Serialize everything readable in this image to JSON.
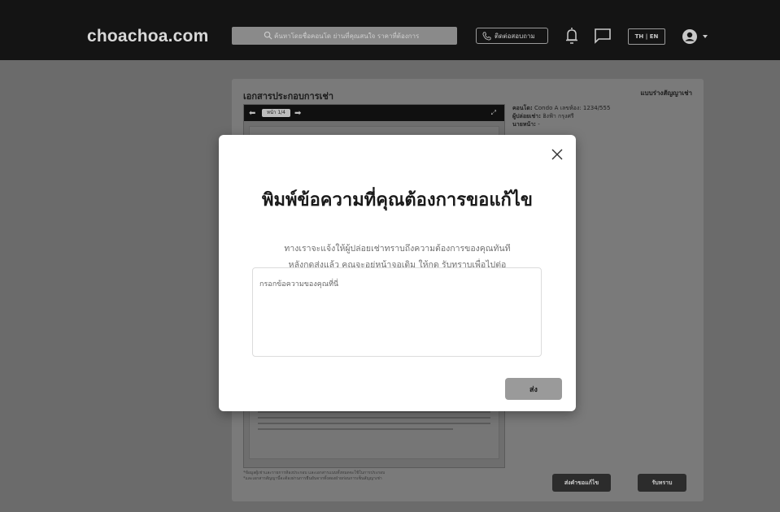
{
  "header": {
    "logo": "choachoa.com",
    "search_placeholder": "ค้นหาโดยชื่อคอนโด ย่านที่คุณสนใจ ราคาที่ต้องการ",
    "contact_label": "ติดต่อสอบถาม",
    "language_label": "TH | EN"
  },
  "card": {
    "title": "เอกสารประกอบการเช่า",
    "right_title": "แบบร่างสัญญาเช่า",
    "page_indicator": "หน้า 1/4",
    "meta": [
      {
        "label": "คอนโด:",
        "value": "Condo A เลขห้อง: 1234/555"
      },
      {
        "label": "ผู้ปล่อยเช่า:",
        "value": "ฮิงฟ้า กรุงศรี"
      },
      {
        "label": "นายหน้า:",
        "value": "-"
      }
    ],
    "footnote_1": "*ข้อมูลผู้เช่าและรายการห้องประกอบ และเอกสารแนบทั้งหมดจะใช้ในการประกอบ",
    "footnote_2": "*และเอกสารสัญญานี้จะต้องผ่านการยืนยันจากทั้งสองฝ่ายก่อนการเซ็นสัญญาเช่า",
    "edit_button": "ส่งคำขอแก้ไข",
    "ack_button": "รับทราบ"
  },
  "modal": {
    "title": "พิมพ์ข้อความที่คุณต้องการขอแก้ไข",
    "desc_line1": "ทางเราจะแจ้งให้ผู้ปล่อยเช่าทราบถึงความต้องการของคุณทันที",
    "desc_line2": "หลังกดส่งแล้ว คุณจะอยู่หน้าจอเดิม ให้กด รับทราบเพื่อไปต่อ",
    "input_placeholder": "กรอกข้อความของคุณที่นี่",
    "send_label": "ส่ง"
  },
  "colors": {
    "topbar": "#141414",
    "overlay": "#6b6b6b",
    "modal_bg": "#ffffff",
    "send_button": "#9a9a9a"
  }
}
